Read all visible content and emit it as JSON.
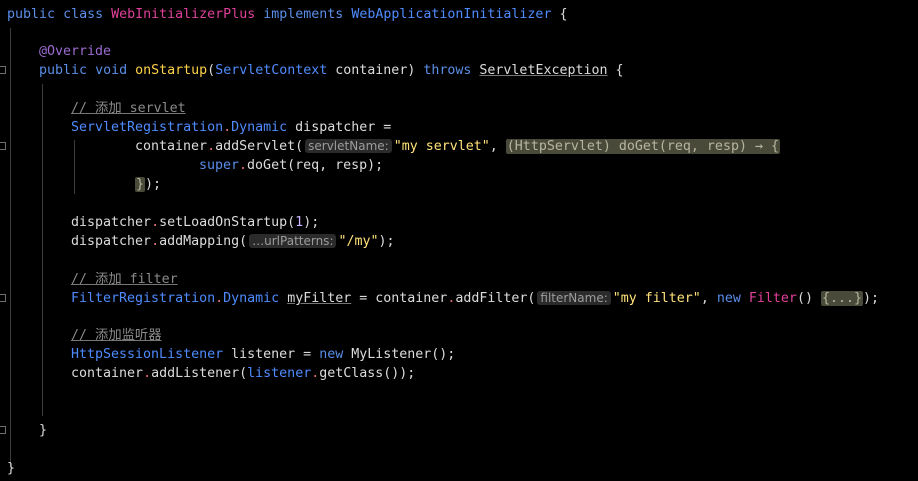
{
  "code": {
    "l1": {
      "kw1": "public",
      "kw2": "class",
      "cls": "WebInitializerPlus",
      "kw3": "implements",
      "iface": "WebApplicationInitializer",
      "brace": " {"
    },
    "l2": {
      "ann": "@Override"
    },
    "l3": {
      "kw1": "public",
      "kw2": "void",
      "fn": "onStartup",
      "p1": "(",
      "type": "ServletContext",
      "arg": " container)",
      "kw3": "throws",
      "ex": "ServletException",
      "brace": " {"
    },
    "l4": {
      "comment": "// 添加 servlet"
    },
    "l5": {
      "type": "ServletRegistration",
      "dot": ".",
      "inner": "Dynamic",
      "rest": " dispatcher ="
    },
    "l6": {
      "obj": "container",
      "dot": ".",
      "call": "addServlet(",
      "hint": "servletName:",
      "str": "\"my servlet\"",
      "comma": ",",
      "fold": "(HttpServlet) doGet(req, resp) → {"
    },
    "l7": {
      "kw": "super",
      "dot": ".",
      "call": "doGet(req, resp);"
    },
    "l8": {
      "fold": "}",
      "rest": ");"
    },
    "l9": {
      "obj": "dispatcher",
      "dot": ".",
      "call": "setLoadOnStartup(",
      "num": "1",
      "end": ");"
    },
    "l10": {
      "obj": "dispatcher",
      "dot": ".",
      "call": "addMapping(",
      "hint": "…urlPatterns:",
      "str": "\"/my\"",
      "end": ");"
    },
    "l11": {
      "comment": "// 添加 filter"
    },
    "l12": {
      "type": "FilterRegistration",
      "dot": ".",
      "inner": "Dynamic",
      "var": "myFilter",
      "mid": " = container",
      "dot2": ".",
      "call": "addFilter(",
      "hint": "filterName:",
      "str": "\"my filter\"",
      "comma": ",",
      "kw": "new",
      "cls": "Filter",
      "paren": "()",
      "fold": "{...}",
      "end": ");"
    },
    "l13": {
      "comment": "// 添加监听器"
    },
    "l14": {
      "type": "HttpSessionListener",
      "rest": " listener = ",
      "kw": "new",
      "ctor": " MyListener();"
    },
    "l15": {
      "obj": "container",
      "dot": ".",
      "call": "addListener(",
      "var": "listener",
      "dot2": ".",
      "call2": "getClass());"
    },
    "l16": {
      "brace": "}"
    },
    "l17": {
      "brace": "}"
    }
  }
}
